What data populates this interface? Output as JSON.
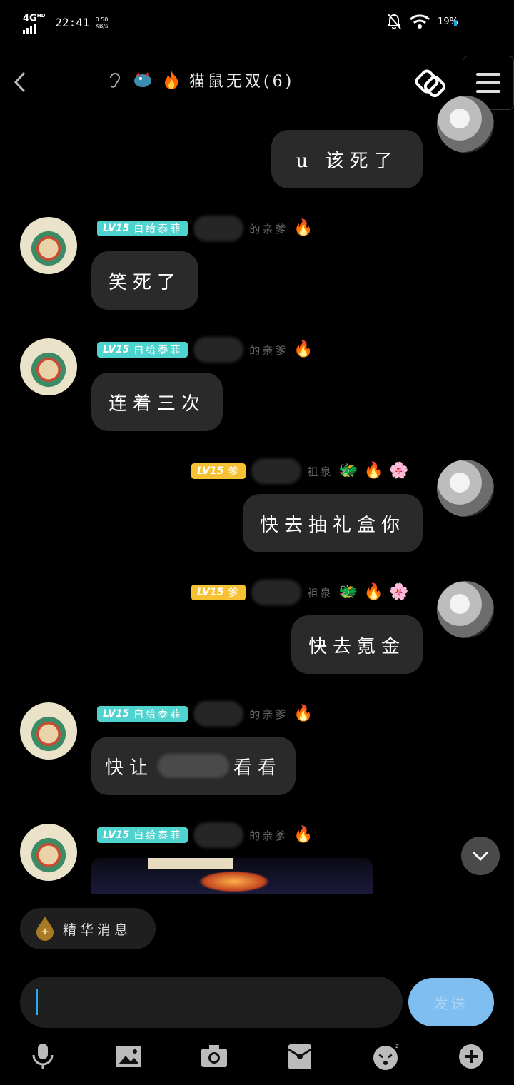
{
  "status_bar": {
    "network": "4G",
    "network_sup": "HD",
    "time": "22:41",
    "speed_value": "0.50",
    "speed_unit": "KB/s",
    "battery": "19%"
  },
  "header": {
    "title": "猫鼠无双(6)",
    "icons": [
      "back-arrow-icon",
      "ear-icon",
      "dragon-icon",
      "fire-icon",
      "share-link-icon",
      "menu-icon"
    ]
  },
  "messages": [
    {
      "side": "right",
      "text": "u 该死了"
    },
    {
      "side": "left",
      "level": "LV15",
      "badge": "白给泰菲",
      "nick": "的亲爹",
      "text": "笑死了"
    },
    {
      "side": "left",
      "level": "LV15",
      "badge": "白给泰菲",
      "nick": "的亲爹",
      "text": "连着三次"
    },
    {
      "side": "right",
      "level": "LV15",
      "badge": "爹",
      "nick": "祖泉",
      "text": "快去抽礼盒你"
    },
    {
      "side": "right",
      "level": "LV15",
      "badge": "爹",
      "nick": "祖泉",
      "text": "快去氪金"
    },
    {
      "side": "left",
      "level": "LV15",
      "badge": "白给泰菲",
      "nick": "的亲爹",
      "text_a": "快让",
      "text_b": "看看"
    },
    {
      "side": "left",
      "level": "LV15",
      "badge": "白给泰菲",
      "nick": "的亲爹",
      "image": "game-screenshot"
    }
  ],
  "essence": {
    "label": "精华消息"
  },
  "input": {
    "value": "",
    "send_label": "发送"
  },
  "toolbar": [
    "microphone-icon",
    "image-icon",
    "camera-icon",
    "red-packet-icon",
    "emoji-icon",
    "plus-icon"
  ],
  "colors": {
    "teal_badge": "#4fd3cf",
    "yellow_badge": "#f6c233",
    "bubble": "#2a2a2a",
    "send": "#7fbef0",
    "cursor": "#2aa9f0"
  }
}
